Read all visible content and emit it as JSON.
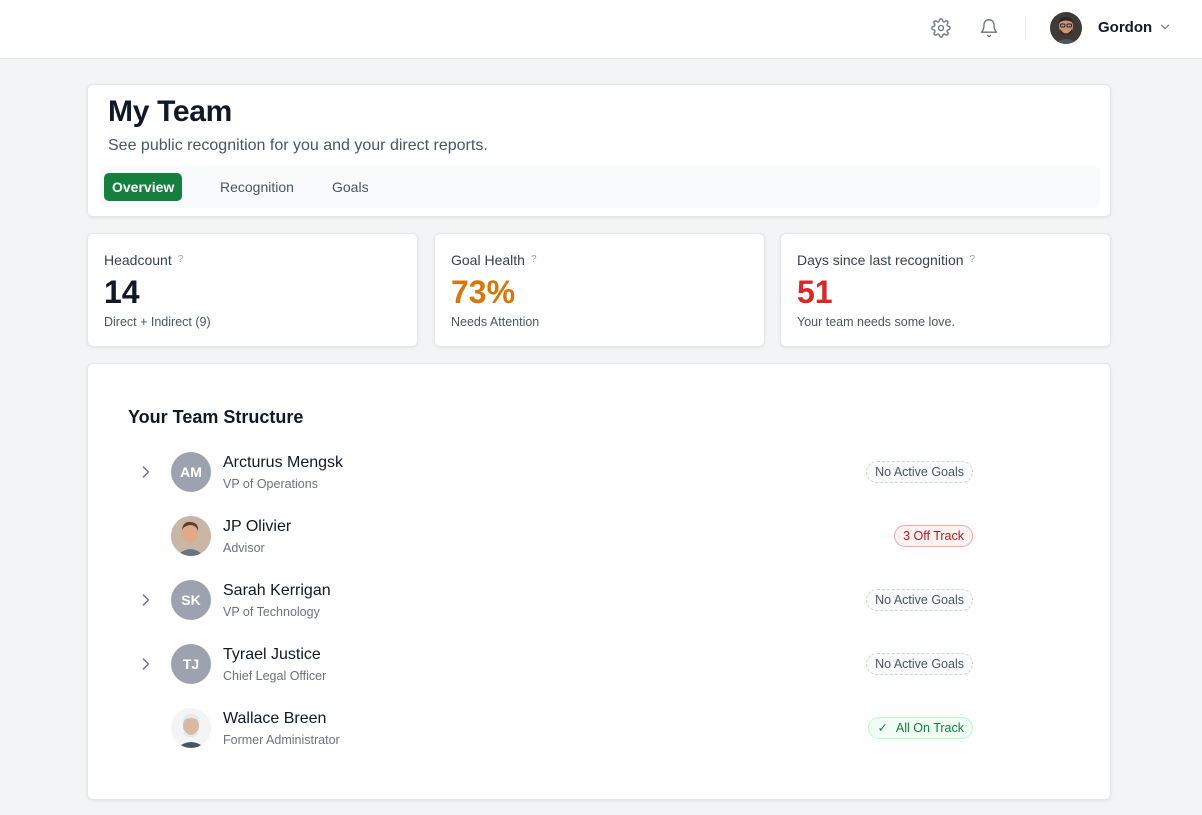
{
  "topbar": {
    "user_name": "Gordon",
    "icons": [
      "gear-icon",
      "bell-icon",
      "chevron-down-icon"
    ]
  },
  "header": {
    "title": "My Team",
    "subtitle": "See public recognition for you and your direct reports.",
    "tabs": [
      {
        "label": "Overview",
        "active": true
      },
      {
        "label": "Recognition",
        "active": false
      },
      {
        "label": "Goals",
        "active": false
      }
    ]
  },
  "stats": [
    {
      "label": "Headcount",
      "help": "?",
      "value": "14",
      "note": "Direct + Indirect (9)",
      "color": "#111827"
    },
    {
      "label": "Goal Health",
      "help": "?",
      "value": "73%",
      "note": "Needs Attention",
      "color": "#d97706"
    },
    {
      "label": "Days since last recognition",
      "help": "?",
      "value": "51",
      "note": "Your team needs some love.",
      "color": "#dc2626"
    }
  ],
  "team": {
    "title": "Your Team Structure",
    "members": [
      {
        "initials": "AM",
        "name": "Arcturus Mengsk",
        "role": "VP of Operations",
        "status": "No Active Goals",
        "status_kind": "neutral",
        "expandable": true
      },
      {
        "initials": "",
        "name": "JP Olivier",
        "role": "Advisor",
        "status": "3 Off Track",
        "status_kind": "red",
        "expandable": false
      },
      {
        "initials": "SK",
        "name": "Sarah Kerrigan",
        "role": "VP of Technology",
        "status": "No Active Goals",
        "status_kind": "neutral",
        "expandable": true
      },
      {
        "initials": "TJ",
        "name": "Tyrael Justice",
        "role": "Chief Legal Officer",
        "status": "No Active Goals",
        "status_kind": "neutral",
        "expandable": true
      },
      {
        "initials": "",
        "name": "Wallace Breen",
        "role": "Former Administrator",
        "status": "All On Track",
        "status_kind": "green",
        "expandable": false
      }
    ]
  },
  "colors": {
    "accent": "#15803d",
    "warning": "#d97706",
    "danger": "#dc2626"
  }
}
